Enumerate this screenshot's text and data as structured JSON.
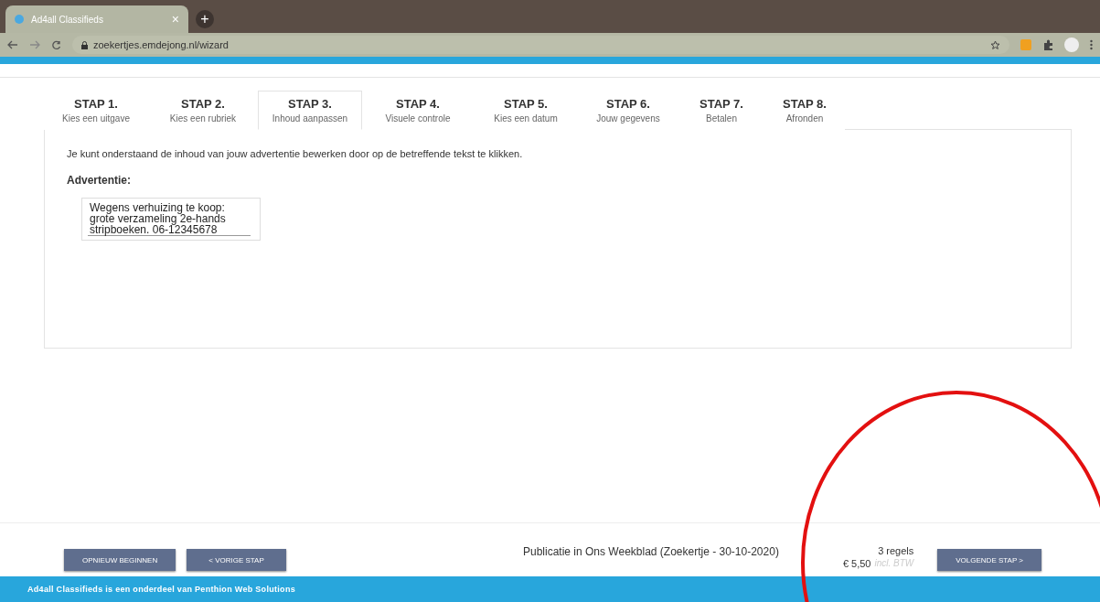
{
  "browser": {
    "tab_title": "Ad4all Classifieds",
    "tab_close": "×",
    "new_tab": "+",
    "url": "zoekertjes.emdejong.nl/wizard"
  },
  "steps": [
    {
      "title": "STAP 1.",
      "label": "Kies een uitgave",
      "selected": false
    },
    {
      "title": "STAP 2.",
      "label": "Kies een rubriek",
      "selected": false
    },
    {
      "title": "STAP 3.",
      "label": "Inhoud aanpassen",
      "selected": true
    },
    {
      "title": "STAP 4.",
      "label": "Visuele controle",
      "selected": false
    },
    {
      "title": "STAP 5.",
      "label": "Kies een datum",
      "selected": false
    },
    {
      "title": "STAP 6.",
      "label": "Jouw gegevens",
      "selected": false
    },
    {
      "title": "STAP 7.",
      "label": "Betalen",
      "selected": false
    },
    {
      "title": "STAP 8.",
      "label": "Afronden",
      "selected": false
    }
  ],
  "intro": "Je kunt onderstaand de inhoud van jouw advertentie bewerken door op de betreffende tekst te klikken.",
  "ad_heading": "Advertentie:",
  "ad_lines": [
    "Wegens verhuizing te koop:",
    "grote verzameling 2e-hands",
    "stripboeken. 06-12345678"
  ],
  "footer": {
    "restart": "OPNIEUW BEGINNEN",
    "previous": "< VORIGE STAP",
    "publication": "Publicatie in Ons Weekblad (Zoekertje - 30-10-2020)",
    "lines": "3 regels",
    "price": "€ 5,50",
    "vat": "incl. BTW",
    "next": "VOLGENDE STAP >"
  },
  "bottom_bar": "Ad4all Classifieds is een onderdeel van Penthion Web Solutions"
}
